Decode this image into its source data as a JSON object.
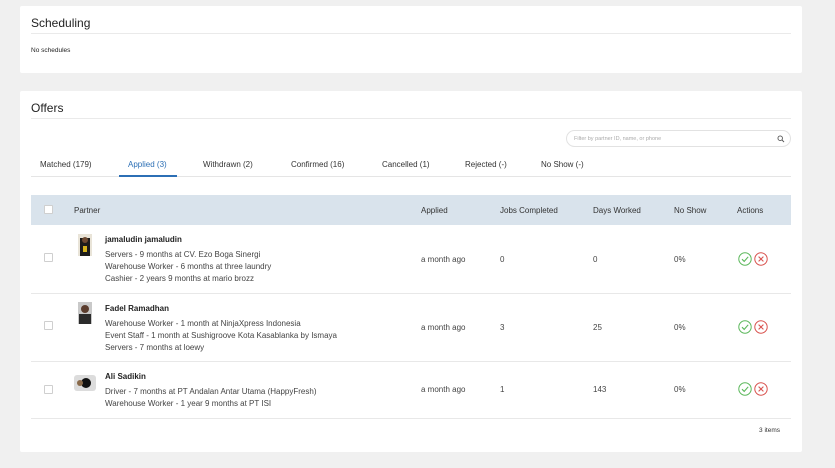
{
  "scheduling": {
    "title": "Scheduling",
    "empty_text": "No schedules"
  },
  "offers": {
    "title": "Offers",
    "filter_placeholder": "Filter by partner ID, name, or phone",
    "tabs": [
      {
        "label": "Matched (179)",
        "active": false
      },
      {
        "label": "Applied (3)",
        "active": true
      },
      {
        "label": "Withdrawn (2)",
        "active": false
      },
      {
        "label": "Confirmed (16)",
        "active": false
      },
      {
        "label": "Cancelled (1)",
        "active": false
      },
      {
        "label": "Rejected (-)",
        "active": false
      },
      {
        "label": "No Show (-)",
        "active": false
      }
    ],
    "columns": [
      "Partner",
      "Applied",
      "Jobs Completed",
      "Days Worked",
      "No Show",
      "Actions"
    ],
    "rows": [
      {
        "name": "jamaludin jamaludin",
        "experience": [
          "Servers - 9 months at CV. Ezo Boga Sinergi",
          "Warehouse Worker - 6 months at three laundry",
          "Cashier - 2 years 9 months at mario brozz"
        ],
        "applied": "a month ago",
        "jobs_completed": "0",
        "days_worked": "0",
        "no_show": "0%"
      },
      {
        "name": "Fadel Ramadhan",
        "experience": [
          "Warehouse Worker - 1 month at NinjaXpress Indonesia",
          "Event Staff - 1 month at Sushigroove Kota Kasablanka by Ismaya",
          "Servers - 7 months at loewy"
        ],
        "applied": "a month ago",
        "jobs_completed": "3",
        "days_worked": "25",
        "no_show": "0%"
      },
      {
        "name": "Ali Sadikin",
        "experience": [
          "Driver - 7 months at PT Andalan Antar Utama (HappyFresh)",
          "Warehouse Worker - 1 year 9 months at PT ISI"
        ],
        "applied": "a month ago",
        "jobs_completed": "1",
        "days_worked": "143",
        "no_show": "0%"
      }
    ],
    "items_count": "3 items"
  },
  "colors": {
    "accent": "#2c6fb5",
    "accept": "#5cb85c",
    "reject": "#d9534f",
    "header_bg": "#d9e3ec"
  }
}
